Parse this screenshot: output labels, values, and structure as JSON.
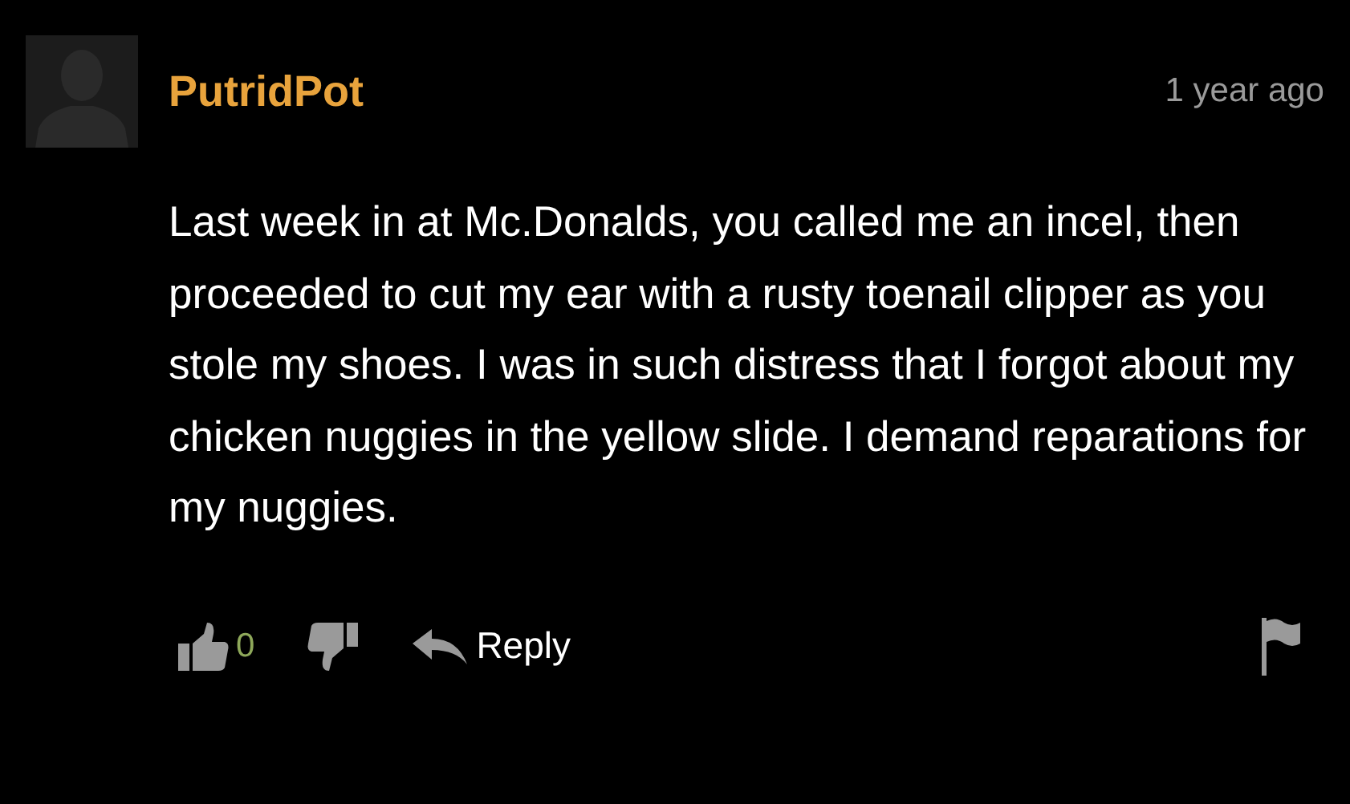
{
  "comment": {
    "author": "PutridPot",
    "time": "1 year ago",
    "text": "Last week in at Mc.Donalds, you called me an incel, then proceeded to cut my ear with a rusty toenail clipper as you stole my shoes. I was in such distress that I forgot about my chicken nuggies in the yellow slide. I demand reparations for my nuggies.",
    "likes": "0",
    "reply_label": "Reply"
  }
}
